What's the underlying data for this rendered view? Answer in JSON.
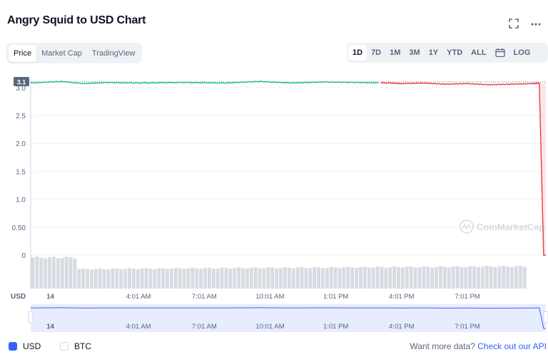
{
  "header": {
    "title": "Angry Squid to USD Chart"
  },
  "icons": {
    "fullscreen": "fullscreen-icon",
    "more": "more-icon",
    "calendar": "calendar-icon"
  },
  "tabs": [
    {
      "label": "Price",
      "active": true
    },
    {
      "label": "Market Cap",
      "active": false
    },
    {
      "label": "TradingView",
      "active": false
    }
  ],
  "ranges": [
    {
      "label": "1D",
      "active": true
    },
    {
      "label": "7D"
    },
    {
      "label": "1M"
    },
    {
      "label": "3M"
    },
    {
      "label": "1Y"
    },
    {
      "label": "YTD"
    },
    {
      "label": "ALL"
    }
  ],
  "log_label": "LOG",
  "currency_label": "USD",
  "watermark": "CoinMarketCap",
  "current_price_badge": "3.1",
  "legend": {
    "usd": "USD",
    "btc": "BTC",
    "usd_checked": true,
    "btc_checked": false
  },
  "footer": {
    "text": "Want more data?",
    "link": "Check out our API"
  },
  "colors": {
    "up": "#16c784",
    "down": "#ea3943",
    "accent": "#3861fb",
    "volume": "#d8dbe2"
  },
  "chart_data": {
    "type": "line",
    "y_ticks": [
      "3.0",
      "2.5",
      "2.0",
      "1.5",
      "1.0",
      "0.50",
      "0"
    ],
    "y_tick_values": [
      3.0,
      2.5,
      2.0,
      1.5,
      1.0,
      0.5,
      0
    ],
    "ylim": [
      0,
      3.1
    ],
    "x_ticks": [
      "14",
      "4:01 AM",
      "7:01 AM",
      "10:01 AM",
      "1:01 PM",
      "4:01 PM",
      "7:01 PM"
    ],
    "x_tick_hours": [
      0,
      4.02,
      7.02,
      10.02,
      13.02,
      16.02,
      19.02
    ],
    "x_range_hours": [
      -0.9,
      22.6
    ],
    "series": [
      {
        "x_hours": [
          -0.9,
          0.5,
          1.5,
          2.5,
          4.0,
          6.0,
          8.0,
          9.5,
          11.0,
          12.5,
          14.0,
          15.5,
          16.0,
          17.0,
          18.0,
          19.0,
          20.0,
          21.0,
          22.0,
          22.3,
          22.5
        ],
        "values": [
          3.08,
          3.11,
          3.07,
          3.09,
          3.08,
          3.09,
          3.08,
          3.11,
          3.08,
          3.1,
          3.09,
          3.08,
          3.07,
          3.08,
          3.06,
          3.07,
          3.05,
          3.06,
          3.07,
          3.08,
          0.0
        ]
      }
    ],
    "change_hour": 15.0,
    "volume_relative": {
      "early_level": 1.0,
      "early_until_hour": 1.3,
      "later_level": 0.62,
      "end_level": 0.72
    }
  }
}
